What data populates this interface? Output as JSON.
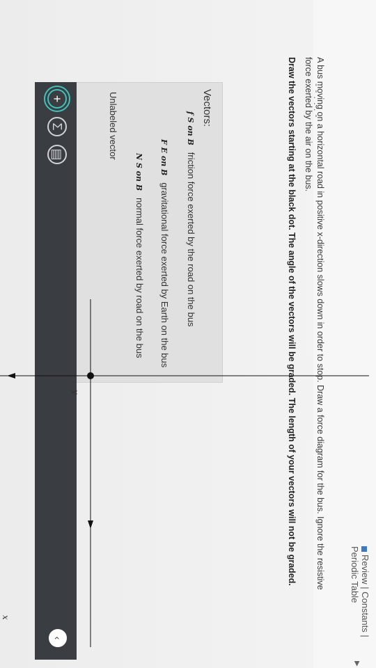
{
  "header": {
    "links_text": "Review | Constants | Periodic Table",
    "dots": "- - . . . -"
  },
  "problem": {
    "text": "A bus moving on a horizontal road in positive x-direction slows down in order to stop. Draw a force diagram for the bus. Ignore the resistive force exerted by the air on the bus.",
    "instruction": "Draw the vectors starting at the black dot. The angle of the vectors will be graded. The length of your vectors will not be graded."
  },
  "toolbar": {
    "add_symbol": "+",
    "sigma_symbol": "Σ",
    "chevron_symbol": "‹"
  },
  "vectors": {
    "title": "Vectors:",
    "items": [
      {
        "symbol": "f S on B",
        "label": "friction force exerted by the road on the bus"
      },
      {
        "symbol": "F E on B",
        "label": "gravitational force exerted by Earth on the bus"
      },
      {
        "symbol": "N S on B",
        "label": "normal force exerted by road on the bus"
      },
      {
        "symbol": "",
        "label": "Unlabeled vector"
      }
    ]
  },
  "axes": {
    "x_label": "x",
    "y_label": "y"
  }
}
